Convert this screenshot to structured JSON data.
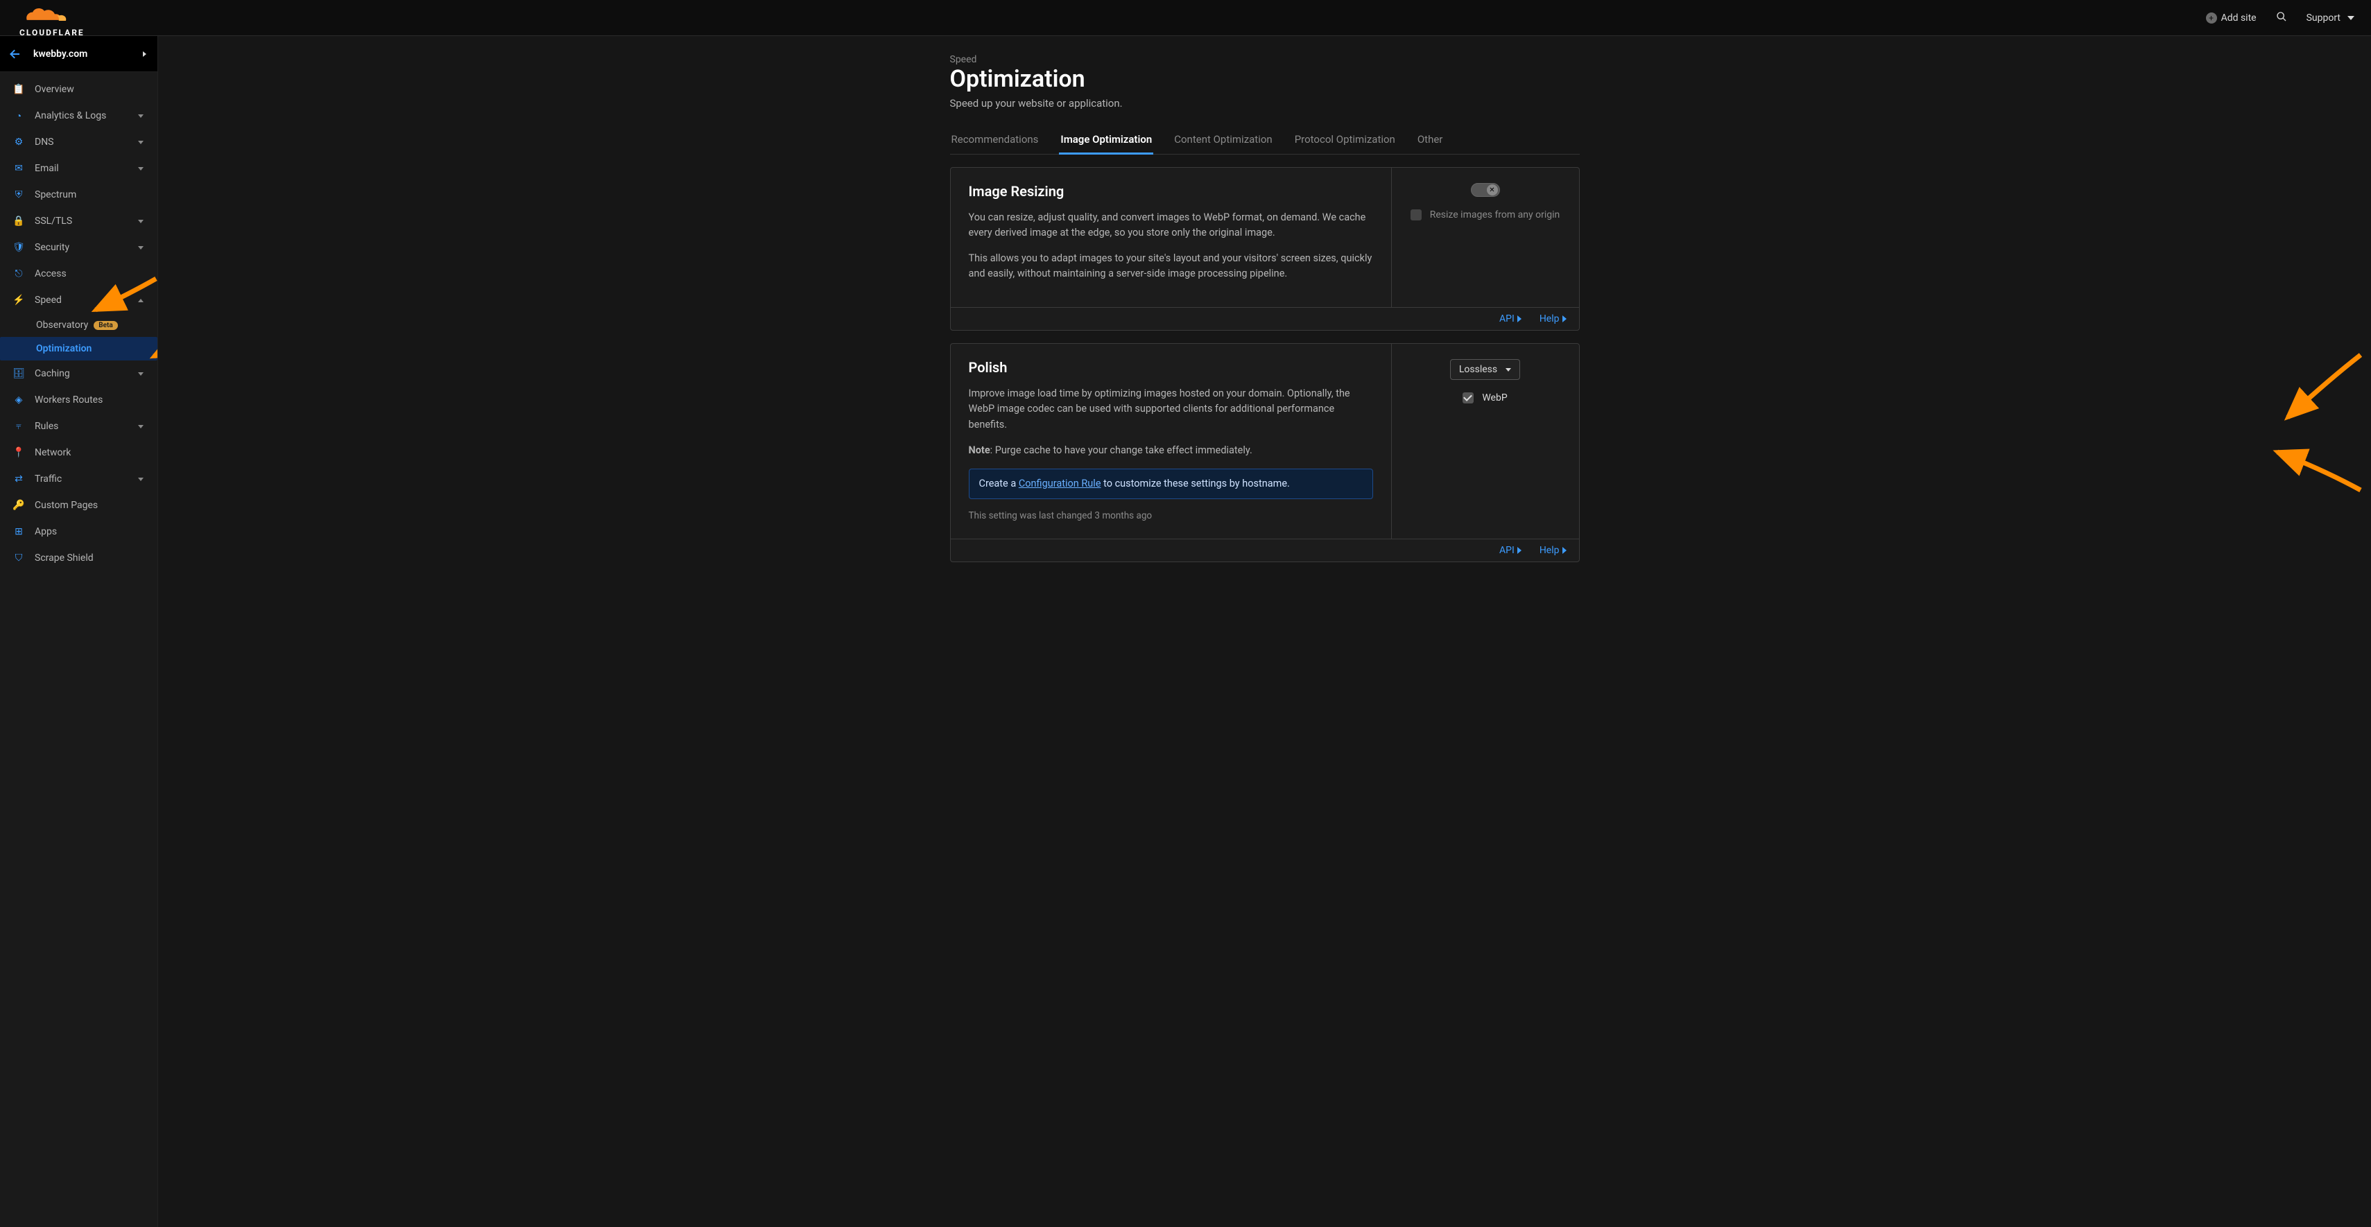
{
  "brand": "CLOUDFLARE",
  "header": {
    "add_site": "Add site",
    "support": "Support"
  },
  "site": {
    "name": "kwebby.com"
  },
  "sidebar": {
    "items": [
      {
        "icon": "clipboard-icon",
        "label": "Overview",
        "expandable": false
      },
      {
        "icon": "clock-icon",
        "label": "Analytics & Logs",
        "expandable": true
      },
      {
        "icon": "network-icon",
        "label": "DNS",
        "expandable": true
      },
      {
        "icon": "mail-icon",
        "label": "Email",
        "expandable": true
      },
      {
        "icon": "shield-check-icon",
        "label": "Spectrum",
        "expandable": false
      },
      {
        "icon": "lock-icon",
        "label": "SSL/TLS",
        "expandable": true
      },
      {
        "icon": "shield-icon",
        "label": "Security",
        "expandable": true
      },
      {
        "icon": "door-icon",
        "label": "Access",
        "expandable": false
      },
      {
        "icon": "bolt-icon",
        "label": "Speed",
        "expandable": true,
        "expanded": true,
        "children": [
          {
            "label": "Observatory",
            "badge": "Beta"
          },
          {
            "label": "Optimization",
            "active": true
          }
        ]
      },
      {
        "icon": "drive-icon",
        "label": "Caching",
        "expandable": true
      },
      {
        "icon": "route-icon",
        "label": "Workers Routes",
        "expandable": false
      },
      {
        "icon": "funnel-icon",
        "label": "Rules",
        "expandable": true
      },
      {
        "icon": "pin-icon",
        "label": "Network",
        "expandable": false
      },
      {
        "icon": "arrows-icon",
        "label": "Traffic",
        "expandable": true
      },
      {
        "icon": "key-icon",
        "label": "Custom Pages",
        "expandable": false
      },
      {
        "icon": "grid-icon",
        "label": "Apps",
        "expandable": false
      },
      {
        "icon": "scrape-icon",
        "label": "Scrape Shield",
        "expandable": false
      }
    ]
  },
  "page": {
    "breadcrumb": "Speed",
    "title": "Optimization",
    "subtitle": "Speed up your website or application."
  },
  "tabs": [
    {
      "label": "Recommendations",
      "active": false
    },
    {
      "label": "Image Optimization",
      "active": true
    },
    {
      "label": "Content Optimization",
      "active": false
    },
    {
      "label": "Protocol Optimization",
      "active": false
    },
    {
      "label": "Other",
      "active": false
    }
  ],
  "cards": {
    "image_resizing": {
      "title": "Image Resizing",
      "desc1": "You can resize, adjust quality, and convert images to WebP format, on demand. We cache every derived image at the edge, so you store only the original image.",
      "desc2": "This allows you to adapt images to your site's layout and your visitors' screen sizes, quickly and easily, without maintaining a server-side image processing pipeline.",
      "right_checkbox_label": "Resize images from any origin",
      "footer_api": "API",
      "footer_help": "Help"
    },
    "polish": {
      "title": "Polish",
      "desc": "Improve image load time by optimizing images hosted on your domain. Optionally, the WebP image codec can be used with supported clients for additional performance benefits.",
      "note_label": "Note",
      "note_text": ": Purge cache to have your change take effect immediately.",
      "callout_prefix": "Create a ",
      "callout_link": "Configuration Rule",
      "callout_suffix": " to customize these settings by hostname.",
      "last_changed": "This setting was last changed 3 months ago",
      "dropdown_value": "Lossless",
      "webp_label": "WebP",
      "footer_api": "API",
      "footer_help": "Help"
    }
  }
}
